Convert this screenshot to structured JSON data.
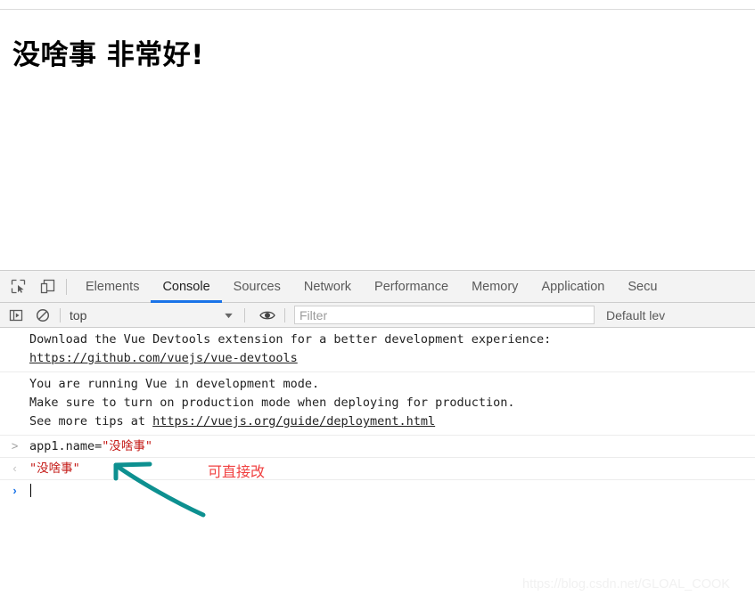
{
  "page": {
    "heading": "没啥事 非常好!",
    "watermark": "https://blog.csdn.net/GLOAL_COOK"
  },
  "devtools": {
    "toolbar_icons": [
      {
        "name": "inspect-element-icon",
        "title": "Inspect element"
      },
      {
        "name": "device-toolbar-icon",
        "title": "Toggle device toolbar"
      }
    ],
    "tabs": [
      {
        "label": "Elements",
        "active": false
      },
      {
        "label": "Console",
        "active": true
      },
      {
        "label": "Sources",
        "active": false
      },
      {
        "label": "Network",
        "active": false
      },
      {
        "label": "Performance",
        "active": false
      },
      {
        "label": "Memory",
        "active": false
      },
      {
        "label": "Application",
        "active": false
      },
      {
        "label": "Secu",
        "active": false
      }
    ],
    "console_toolbar": {
      "sidebar_icon": "console-sidebar-icon",
      "clear_icon": "clear-console-icon",
      "eye_icon": "live-expression-icon",
      "context": "top",
      "context_caret": "▼",
      "filter_placeholder": "Filter",
      "filter_value": "",
      "level": "Default lev"
    },
    "messages": [
      {
        "lines": [
          {
            "text": "Download the Vue Devtools extension for a better development experience:",
            "link": false
          },
          {
            "text": "https://github.com/vuejs/vue-devtools",
            "link": true
          }
        ]
      },
      {
        "lines": [
          {
            "text": "You are running Vue in development mode.",
            "link": false
          },
          {
            "text": "Make sure to turn on production mode when deploying for production.",
            "link": false
          },
          {
            "text": "See more tips at ",
            "link": false,
            "suffix_link": "https://vuejs.org/guide/deployment.html"
          }
        ]
      }
    ],
    "command_input": {
      "prompt": ">",
      "expression": "app1.name=",
      "value": "\"没啥事\""
    },
    "command_result": {
      "prompt": "‹",
      "value": "\"没啥事\""
    },
    "new_prompt": {
      "prompt": "›",
      "value": ""
    }
  },
  "annotations": {
    "note": "可直接改",
    "note_color": "#f04040",
    "arrow_color": "#0d9090"
  }
}
